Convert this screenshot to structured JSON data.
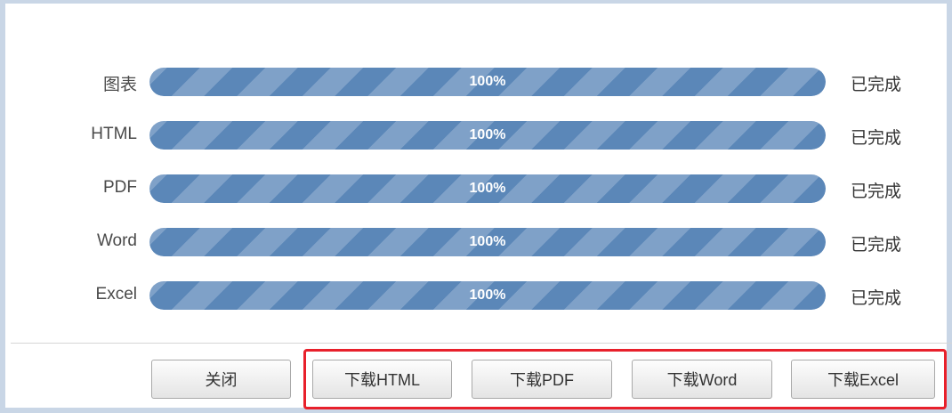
{
  "accent_colors": {
    "bar_fill": "#5b87b8",
    "highlight_border": "#e8202b"
  },
  "progress_rows": [
    {
      "label": "图表",
      "percent_text": "100%",
      "progress": 1.0,
      "status": "已完成"
    },
    {
      "label": "HTML",
      "percent_text": "100%",
      "progress": 1.0,
      "status": "已完成"
    },
    {
      "label": "PDF",
      "percent_text": "100%",
      "progress": 1.0,
      "status": "已完成"
    },
    {
      "label": "Word",
      "percent_text": "100%",
      "progress": 1.0,
      "status": "已完成"
    },
    {
      "label": "Excel",
      "percent_text": "100%",
      "progress": 1.0,
      "status": "已完成"
    }
  ],
  "footer": {
    "close_label": "关闭",
    "download_html_label": "下载HTML",
    "download_pdf_label": "下载PDF",
    "download_word_label": "下载Word",
    "download_excel_label": "下载Excel"
  }
}
